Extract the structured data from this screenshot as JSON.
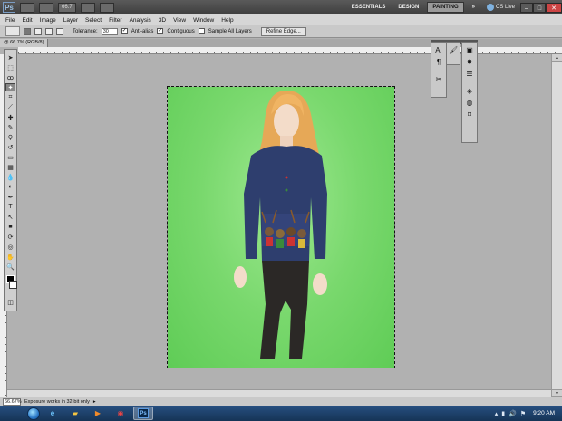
{
  "app": {
    "logo": "Ps",
    "zoom": "66.7",
    "workspaces": [
      "ESSENTIALS",
      "DESIGN",
      "PAINTING"
    ],
    "active_workspace": "PAINTING",
    "overflow": "»",
    "cs_live": "CS Live",
    "window_controls": {
      "minimize": "–",
      "maximize": "□",
      "close": "✕"
    }
  },
  "menu": [
    "File",
    "Edit",
    "Image",
    "Layer",
    "Select",
    "Filter",
    "Analysis",
    "3D",
    "View",
    "Window",
    "Help"
  ],
  "options": {
    "tolerance_label": "Tolerance:",
    "tolerance_value": "30",
    "anti_alias": "Anti-alias",
    "contiguous": "Contiguous",
    "sample_all_layers": "Sample All Layers",
    "refine_edge": "Refine Edge..."
  },
  "document": {
    "tab": "@ 66.7% (RGB/8)"
  },
  "status": {
    "zoom": "66.67%",
    "message": "Exposure works in 32-bit only"
  },
  "taskbar": {
    "time": "9:20 AM",
    "ps_label": "Ps"
  },
  "colors": {
    "canvas_green": "#79d86d",
    "hair": "#e8a95a",
    "sweater": "#2e3e6e",
    "pants": "#2b2826"
  }
}
